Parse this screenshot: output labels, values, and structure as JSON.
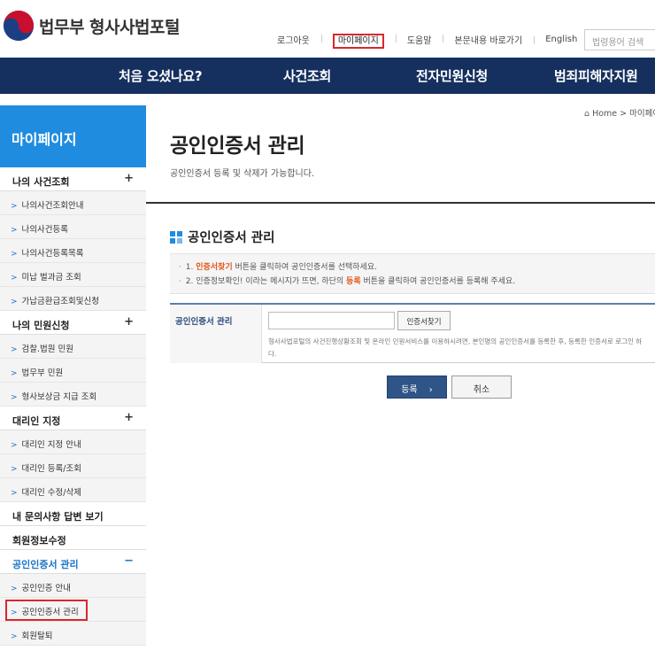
{
  "header": {
    "logo_text": "법무부 형사사법포털",
    "util_nav": [
      "로그아웃",
      "마이페이지",
      "도움말",
      "본문내용 바로가기",
      "English"
    ],
    "search_placeholder": "법령용어 검색"
  },
  "gnb": [
    "처음 오셨나요?",
    "사건조회",
    "전자민원신청",
    "범죄피해자지원"
  ],
  "sidebar": {
    "title": "마이페이지",
    "groups": [
      {
        "label": "나의 사건조회",
        "toggle": "+",
        "items": [
          "나의사건조회안내",
          "나의사건등록",
          "나의사건등록목록",
          "미납 벌과금 조회",
          "가납금환급조회및신청"
        ]
      },
      {
        "label": "나의 민원신청",
        "toggle": "+",
        "items": [
          "검찰.법원 민원",
          "법무부 민원",
          "형사보상금 지급 조회"
        ]
      },
      {
        "label": "대리인 지정",
        "toggle": "+",
        "items": [
          "대리인 지정 안내",
          "대리인 등록/조회",
          "대리인 수정/삭제"
        ]
      }
    ],
    "plain_items": [
      "내 문의사항 답변 보기",
      "회원정보수정"
    ],
    "open_group": {
      "label": "공인인증서 관리",
      "toggle": "−"
    },
    "open_items": [
      "공인인증 안내",
      "공인인증서 관리",
      "회원탈퇴"
    ]
  },
  "breadcrumb": {
    "icon": "home-icon",
    "home": "Home",
    "sep": ">",
    "current": "마이페이지"
  },
  "page": {
    "title": "공인인증서 관리",
    "desc": "공인인증서 등록 및 삭제가 가능합니다.",
    "section_title": "공인인증서 관리"
  },
  "notice": {
    "line1": {
      "num": "1.",
      "em": "인증서찾기",
      "rest": " 버튼을 클릭하여 공인인증서를 선택하세요."
    },
    "line2": {
      "num": "2.",
      "pre": "인증정보확인! 이라는 메시지가 뜨면, 하단의 ",
      "em": "등록",
      "rest": " 버튼을 클릭하여 공인인증서를 등록해 주세요."
    }
  },
  "form": {
    "label": "공인인증서 관리",
    "input_value": "",
    "find_button": "인증서찾기",
    "help_line1": "형사사법포털의 사건진행상황조회 및 온라인 민원서비스를 이용하시려면, 본인명의 공인인증서를 등록한 후, 등록한 인증서로 로그인 하",
    "help_line2": "다."
  },
  "buttons": {
    "register": "등록",
    "register_arrow": "›",
    "cancel": "취소"
  },
  "colors": {
    "gnb": "#15305f",
    "sidebar_title": "#1f8ce0",
    "highlight": "#d9272e",
    "accent": "#e0561c"
  }
}
